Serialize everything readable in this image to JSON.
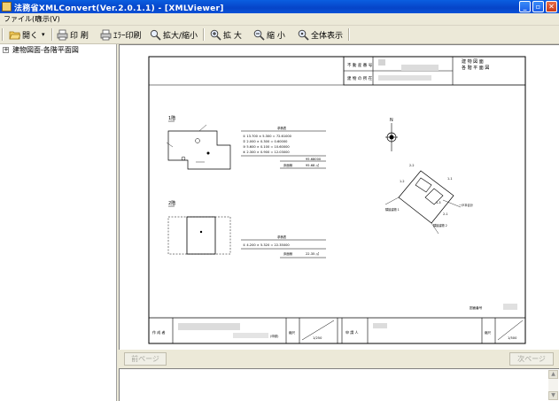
{
  "window": {
    "title": "法務省XMLConvert(Ver.2.0.1.1) - [XMLViewer]",
    "minimize_glyph": "_",
    "restore_glyph": "▫",
    "close_glyph": "✕"
  },
  "menu": {
    "items": [
      "ファイル(F)",
      "表示(V)"
    ]
  },
  "toolbar": {
    "open": "開く",
    "print": "印 刷",
    "error_print": "ｴﾗｰ印刷",
    "zoom_toggle": "拡大/縮小",
    "zoom_in": "拡 大",
    "zoom_out": "縮 小",
    "fit_all": "全体表示"
  },
  "tree": {
    "items": [
      {
        "expander": "+",
        "label": "建物図面-各階平面図"
      }
    ]
  },
  "drawing": {
    "header_row1_label": "不 動 産 番 号",
    "header_row2_label": "建 物 の 所 在",
    "header_right1": "建 物 図 面",
    "header_right2": "各 階 平 面 図",
    "floor1_label": "1階",
    "floor2_label": "2階",
    "floor1_table_title": "求積表",
    "floor1_rows": [
      "① 13.700 × 5.300 = 72.61000",
      "② 2.000 × 0.300 = 0.60000",
      "③ 5.600 × 0.100 = 10.60000",
      "④ 2.300 × 0.900 = 12.03000"
    ],
    "floor1_sum": "95.68000",
    "floor1_area": "95.68 ㎡",
    "floor2_table_title": "求積表",
    "floor2_row": "① 4.200 × 5.320 = 22.35000",
    "floor2_area": "22.35 ㎡",
    "area_label_small": "床面積",
    "north_label": "N",
    "site_labels": [
      "2-2",
      "1-1",
      "1-3",
      "1-2",
      "2-1",
      "一戸本合計"
    ],
    "site_note1": "隣接建物 1",
    "site_note2": "隣接建物 2",
    "image_number_label": "図面番号",
    "footer_author_label": "作 成 者",
    "footer_author_note": "(申請)",
    "footer_scale_label1": "縮尺",
    "footer_scale_value1": "1/250",
    "footer_applicant_label": "申 請 人",
    "footer_scale_label2": "縮尺",
    "footer_scale_value2": "1/500"
  },
  "navigation": {
    "prev": "前ページ",
    "next": "次ページ"
  }
}
